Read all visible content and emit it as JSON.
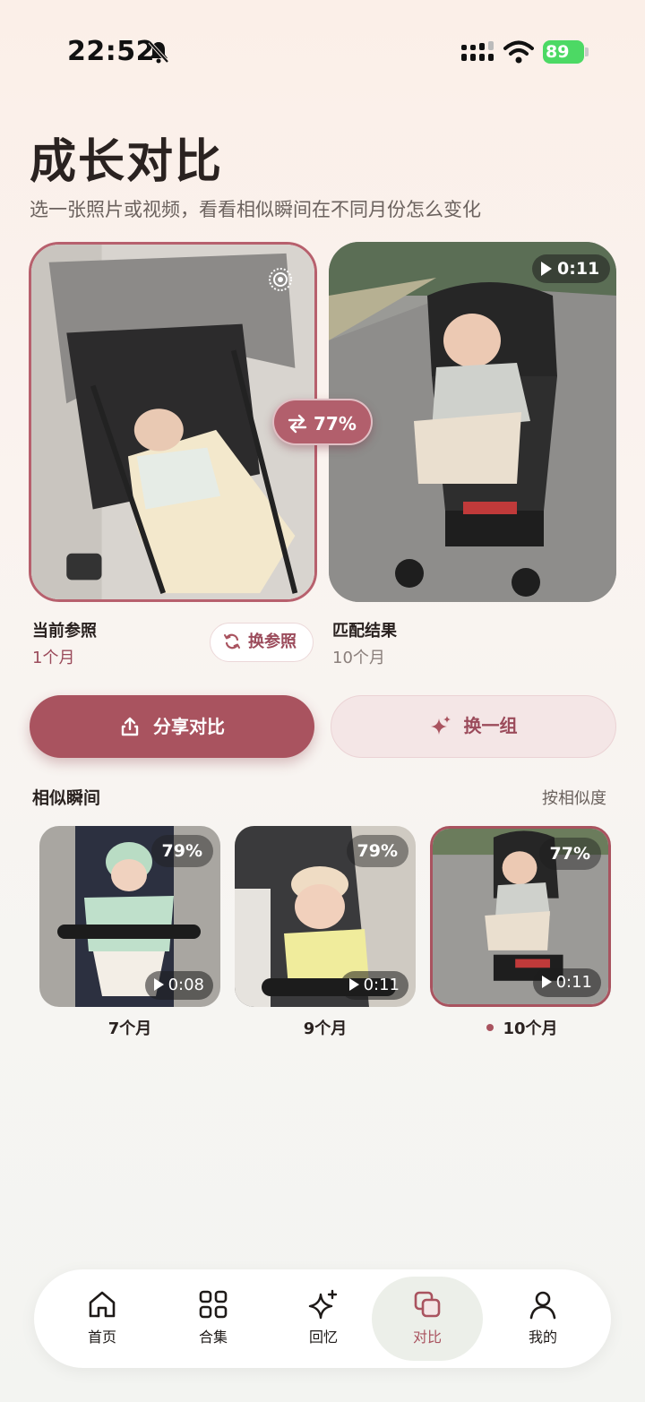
{
  "status_bar": {
    "time": "22:52",
    "battery": "89"
  },
  "header": {
    "title": "成长对比",
    "subtitle": "选一张照片或视频，看看相似瞬间在不同月份怎么变化"
  },
  "comparison": {
    "similarity": "77%",
    "reference": {
      "label": "当前参照",
      "age": "1个月",
      "change_button": "换参照"
    },
    "match": {
      "label": "匹配结果",
      "age": "10个月",
      "duration": "0:11"
    }
  },
  "actions": {
    "share": "分享对比",
    "shuffle": "换一组"
  },
  "similar": {
    "title": "相似瞬间",
    "sort": "按相似度",
    "items": [
      {
        "similarity": "79%",
        "duration": "0:08",
        "age": "7个月",
        "selected": false
      },
      {
        "similarity": "79%",
        "duration": "0:11",
        "age": "9个月",
        "selected": false
      },
      {
        "similarity": "77%",
        "duration": "0:11",
        "age": "10个月",
        "selected": true
      }
    ]
  },
  "tabbar": {
    "tabs": [
      {
        "label": "首页",
        "icon": "home-icon"
      },
      {
        "label": "合集",
        "icon": "grid-icon"
      },
      {
        "label": "回忆",
        "icon": "sparkle-icon"
      },
      {
        "label": "对比",
        "icon": "compare-icon",
        "active": true
      },
      {
        "label": "我的",
        "icon": "person-icon"
      }
    ]
  },
  "colors": {
    "accent": "#a9535f",
    "accent_light": "#f4e6e6",
    "text": "#2a2220"
  }
}
